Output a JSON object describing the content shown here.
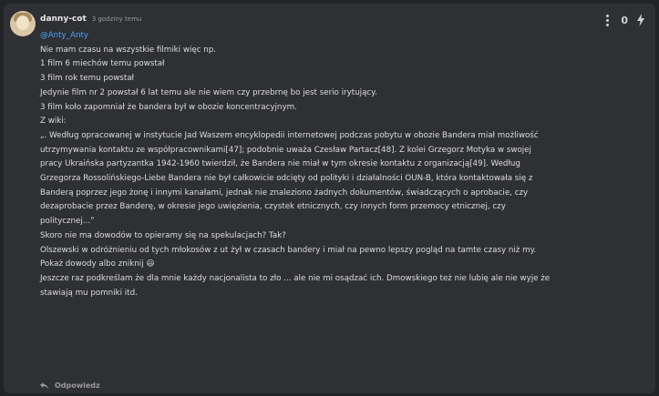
{
  "comment": {
    "username": "danny-cot",
    "timestamp": "3 godziny temu",
    "vote_count": "0",
    "mention": "@Anty_Anty",
    "lines": [
      "Nie mam czasu na wszystkie filmiki więc np.",
      "1 film 6 miechów temu powstał",
      "3 film rok temu powstał",
      "Jedynie film nr 2 powstał 6 lat temu ale nie wiem czy przebrnę bo jest serio irytujący.",
      "3 film koło zapomniał że bandera był w obozie koncentracyjnym.",
      "",
      "Z wiki:",
      "„. Według opracowanej w instytucie Jad Waszem encyklopedii internetowej podczas pobytu w obozie Bandera miał możliwość",
      "utrzymywania kontaktu ze współpracownikami[47]; podobnie uważa Czesław Partacz[48]. Z kolei Grzegorz Motyka w swojej",
      "pracy Ukraińska partyzantka 1942-1960 twierdził, że Bandera nie miał w tym okresie kontaktu z organizacją[49]. Według",
      "Grzegorza Rossolińskiego-Liebe Bandera nie był całkowicie odcięty od polityki i działalności OUN-B, która kontaktowała się z",
      "Banderą poprzez jego żonę i innymi kanałami, jednak nie znaleziono żadnych dokumentów, świadczących o aprobacie, czy",
      "dezaprobacie przez Banderę, w okresie jego uwięzienia, czystek etnicznych, czy innych form przemocy etnicznej, czy",
      "politycznej...”",
      "",
      "Skoro nie ma dowodów to opieramy się na spekulacjach? Tak?",
      "",
      "Olszewski w odróżnieniu od tych młokosów z ut żył w czasach bandery i miał na pewno lepszy pogląd na tamte czasy niż my.",
      "",
      "Pokaż dowody albo zniknij 😃",
      "",
      "Jeszcze raz podkreślam że dla mnie każdy nacjonalista to zło ... ale nie mi osądzać ich. Dmowskiego też nie lubię ale nie wyje że",
      "stawiają mu pomniki itd."
    ],
    "reply_label": "Odpowiedz"
  },
  "colors": {
    "mention": "#4aa3ff",
    "background": "#2f3033"
  },
  "icons": {
    "menu": "more-vertical-icon",
    "boost": "lightning-icon",
    "reply": "reply-arrow-icon"
  }
}
